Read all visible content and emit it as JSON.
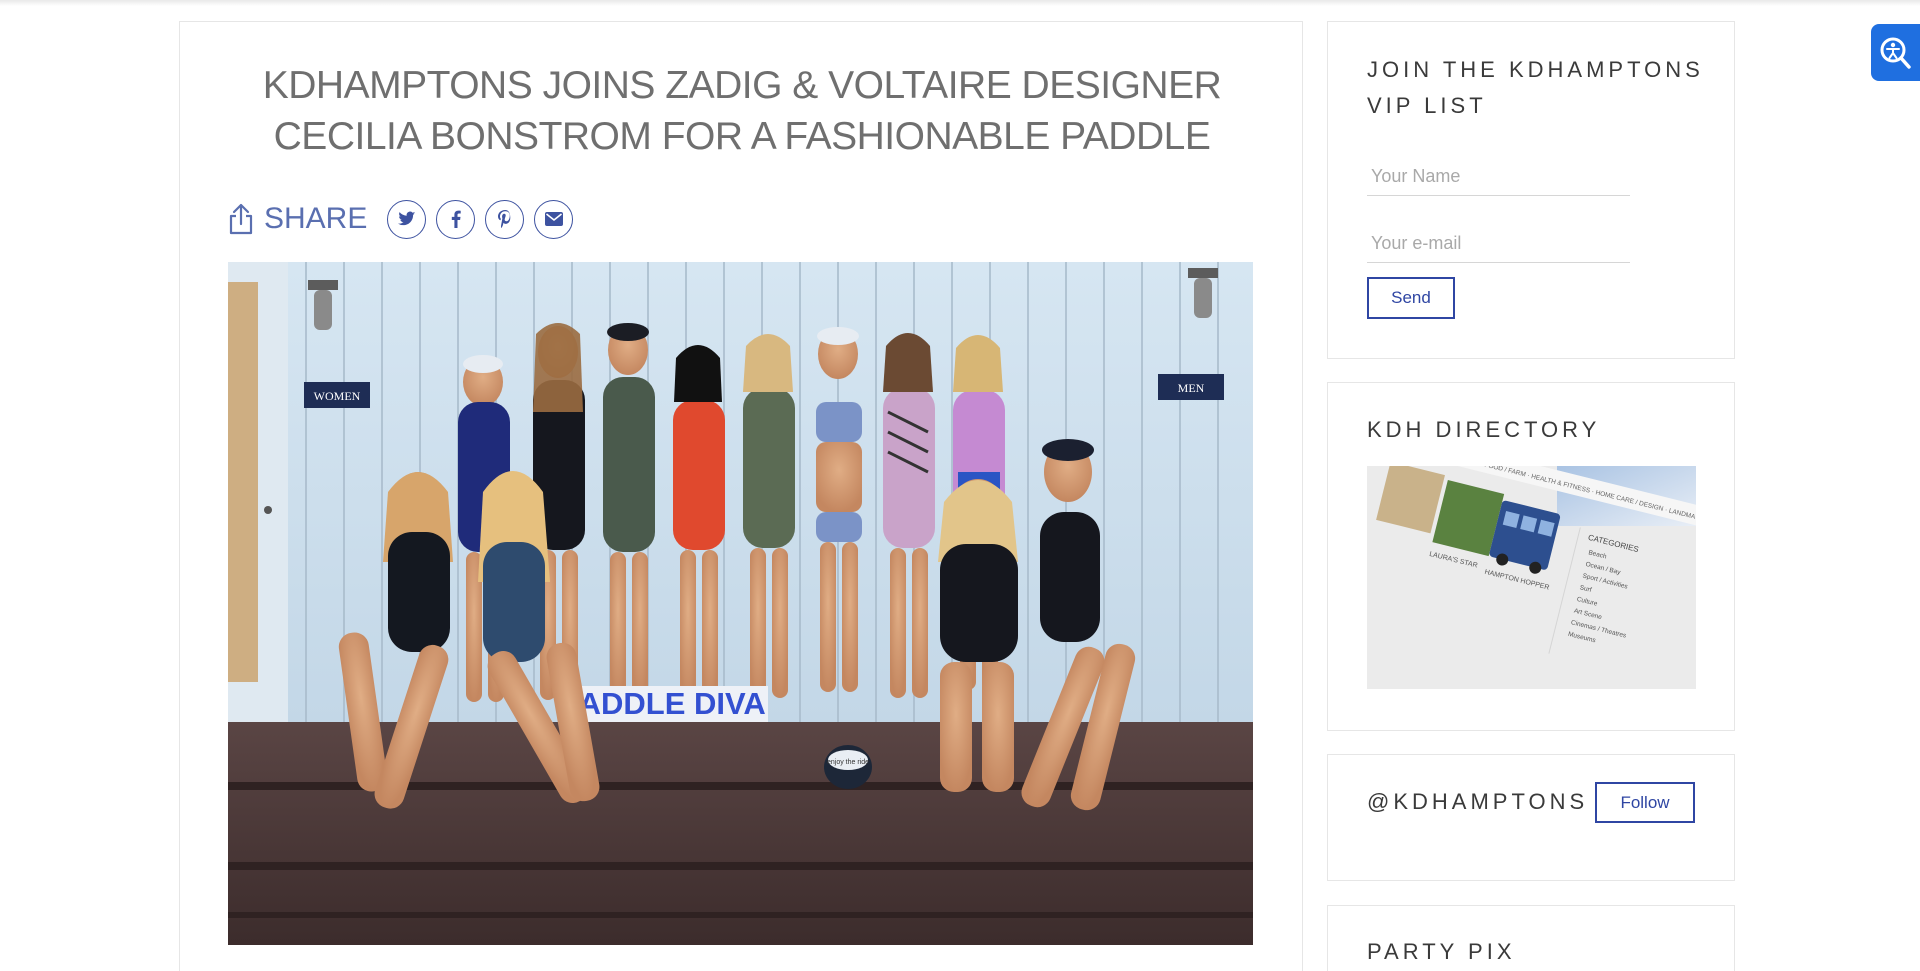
{
  "article": {
    "title": "KDHAMPTONS JOINS ZADIG & VOLTAIRE DESIGNER CECILIA BONSTROM FOR A FASHIONABLE PADDLE",
    "share_label": "SHARE",
    "social_buttons": [
      "twitter-icon",
      "facebook-icon",
      "pinterest-icon",
      "email-icon"
    ],
    "photo": {
      "sign_women": "WOMEN",
      "sign_men": "MEN",
      "banner": "PADDLE DIVA",
      "hat_text": "enjoy the ride"
    }
  },
  "sidebar": {
    "vip": {
      "title": "JOIN THE KDHAMPTONS VIP LIST",
      "name_placeholder": "Your Name",
      "email_placeholder": "Your e-mail",
      "send_label": "Send"
    },
    "directory": {
      "title": "KDH DIRECTORY",
      "image_text": {
        "nav": "FOOD / FARM · HEALTH & FITNESS · HOME CARE / DESIGN · LANDMA",
        "categories": "CATEGORIES",
        "items": [
          "Beach",
          "Ocean / Bay",
          "Sport / Activities",
          "Surf",
          "Culture",
          "Art Scene",
          "Cinemas / Theatres",
          "Museums"
        ],
        "tile_a": "LAURA'S STAR",
        "tile_b": "HAMPTON HOPPER"
      }
    },
    "instagram": {
      "handle": "@KDHAMPTONS",
      "follow_label": "Follow"
    },
    "party": {
      "title": "PARTY PIX"
    }
  },
  "colors": {
    "accent": "#2f46a3",
    "share_text": "#5a6fb0",
    "title_text": "#6f6f6f",
    "accessibility": "#1f6fe0"
  }
}
